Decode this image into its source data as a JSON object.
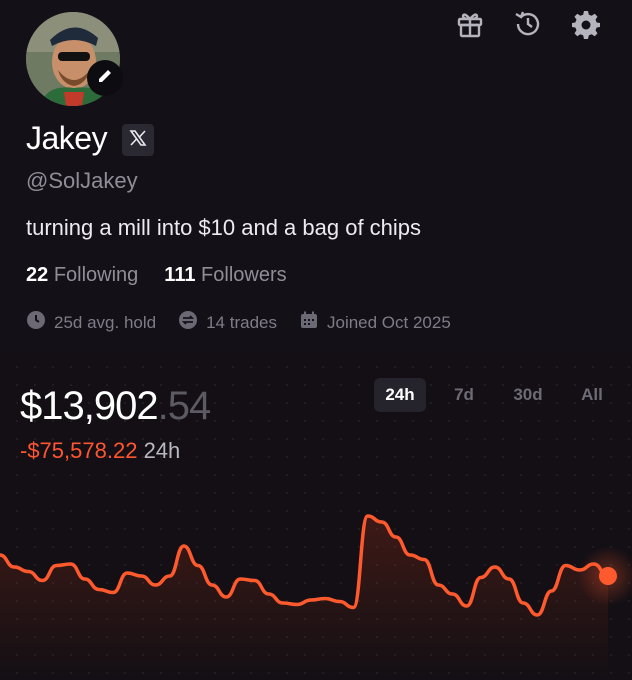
{
  "profile": {
    "name": "Jakey",
    "handle": "@SolJakey",
    "bio": "turning a mill into $10 and a bag of chips",
    "following_count": "22",
    "following_label": "Following",
    "followers_count": "111",
    "followers_label": "Followers",
    "avg_hold": "25d avg. hold",
    "trades": "14 trades",
    "joined": "Joined Oct 2025"
  },
  "icons": {
    "edit": "pencil-icon",
    "x": "x-logo-icon",
    "gift": "gift-icon",
    "history": "history-icon",
    "settings": "gear-icon",
    "hold": "clock-icon",
    "trades": "swap-icon",
    "joined": "calendar-icon"
  },
  "portfolio": {
    "value_main": "$13,902",
    "value_cents": ".54",
    "change": "-$75,578.22",
    "change_period": "24h",
    "ranges": [
      "24h",
      "7d",
      "30d",
      "All"
    ],
    "active_range": "24h"
  },
  "colors": {
    "accent": "#ff5a2e",
    "negative": "#ff5532",
    "background": "#131018"
  },
  "chart_data": {
    "type": "line",
    "title": "",
    "y": [
      58,
      50,
      47,
      41,
      51,
      52,
      42,
      35,
      33,
      46,
      44,
      38,
      44,
      64,
      51,
      38,
      30,
      42,
      41,
      32,
      26,
      25,
      28,
      29,
      27,
      23,
      84,
      80,
      70,
      58,
      55,
      38,
      32,
      24,
      43,
      50,
      42,
      26,
      18,
      34,
      51,
      48,
      52,
      44
    ],
    "ylim": [
      0,
      100
    ]
  }
}
